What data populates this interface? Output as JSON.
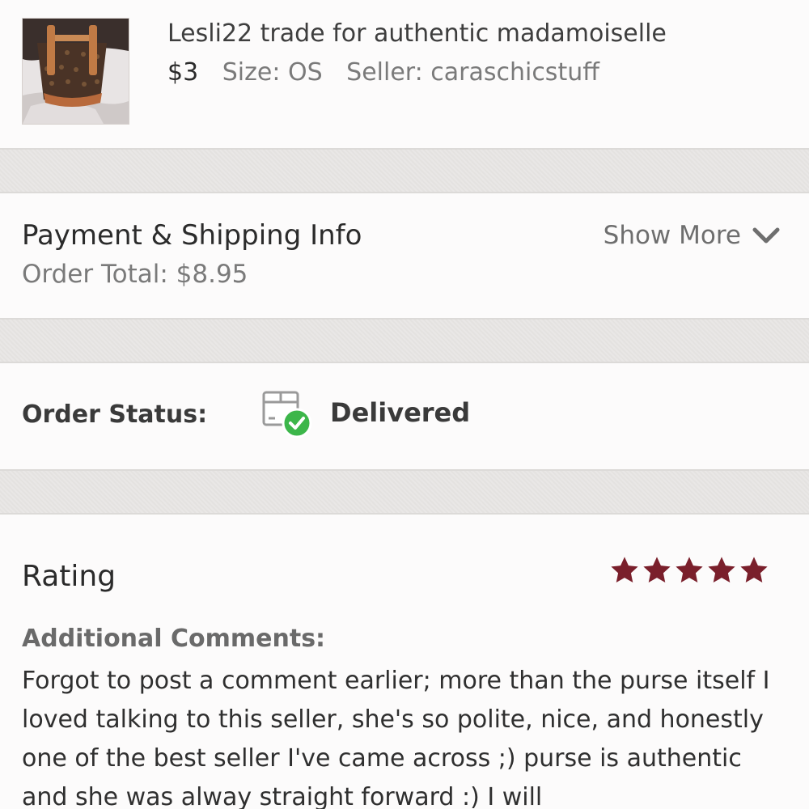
{
  "item": {
    "title": "Lesli22 trade for authentic madamoiselle",
    "price": "$3",
    "size": "Size: OS",
    "seller": "Seller: caraschicstuff",
    "thumbnail_icon": "handbag-photo"
  },
  "payment": {
    "title": "Payment & Shipping Info",
    "order_total": "Order Total: $8.95",
    "show_more_label": "Show More",
    "show_more_icon": "chevron-down-icon"
  },
  "status": {
    "label": "Order Status:",
    "value": "Delivered",
    "icon": "package-delivered-icon",
    "check_color": "#3cb64a"
  },
  "rating": {
    "title": "Rating",
    "stars": 5,
    "max_stars": 5,
    "star_color": "#7a1f2b",
    "comments_label": "Additional Comments:",
    "comment_text": "Forgot to post a comment earlier; more than the purse itself I loved talking to this seller, she's so polite, nice, and honestly one of the best seller I've came across ;) purse is authentic and she was alway straight forward :) I will"
  }
}
